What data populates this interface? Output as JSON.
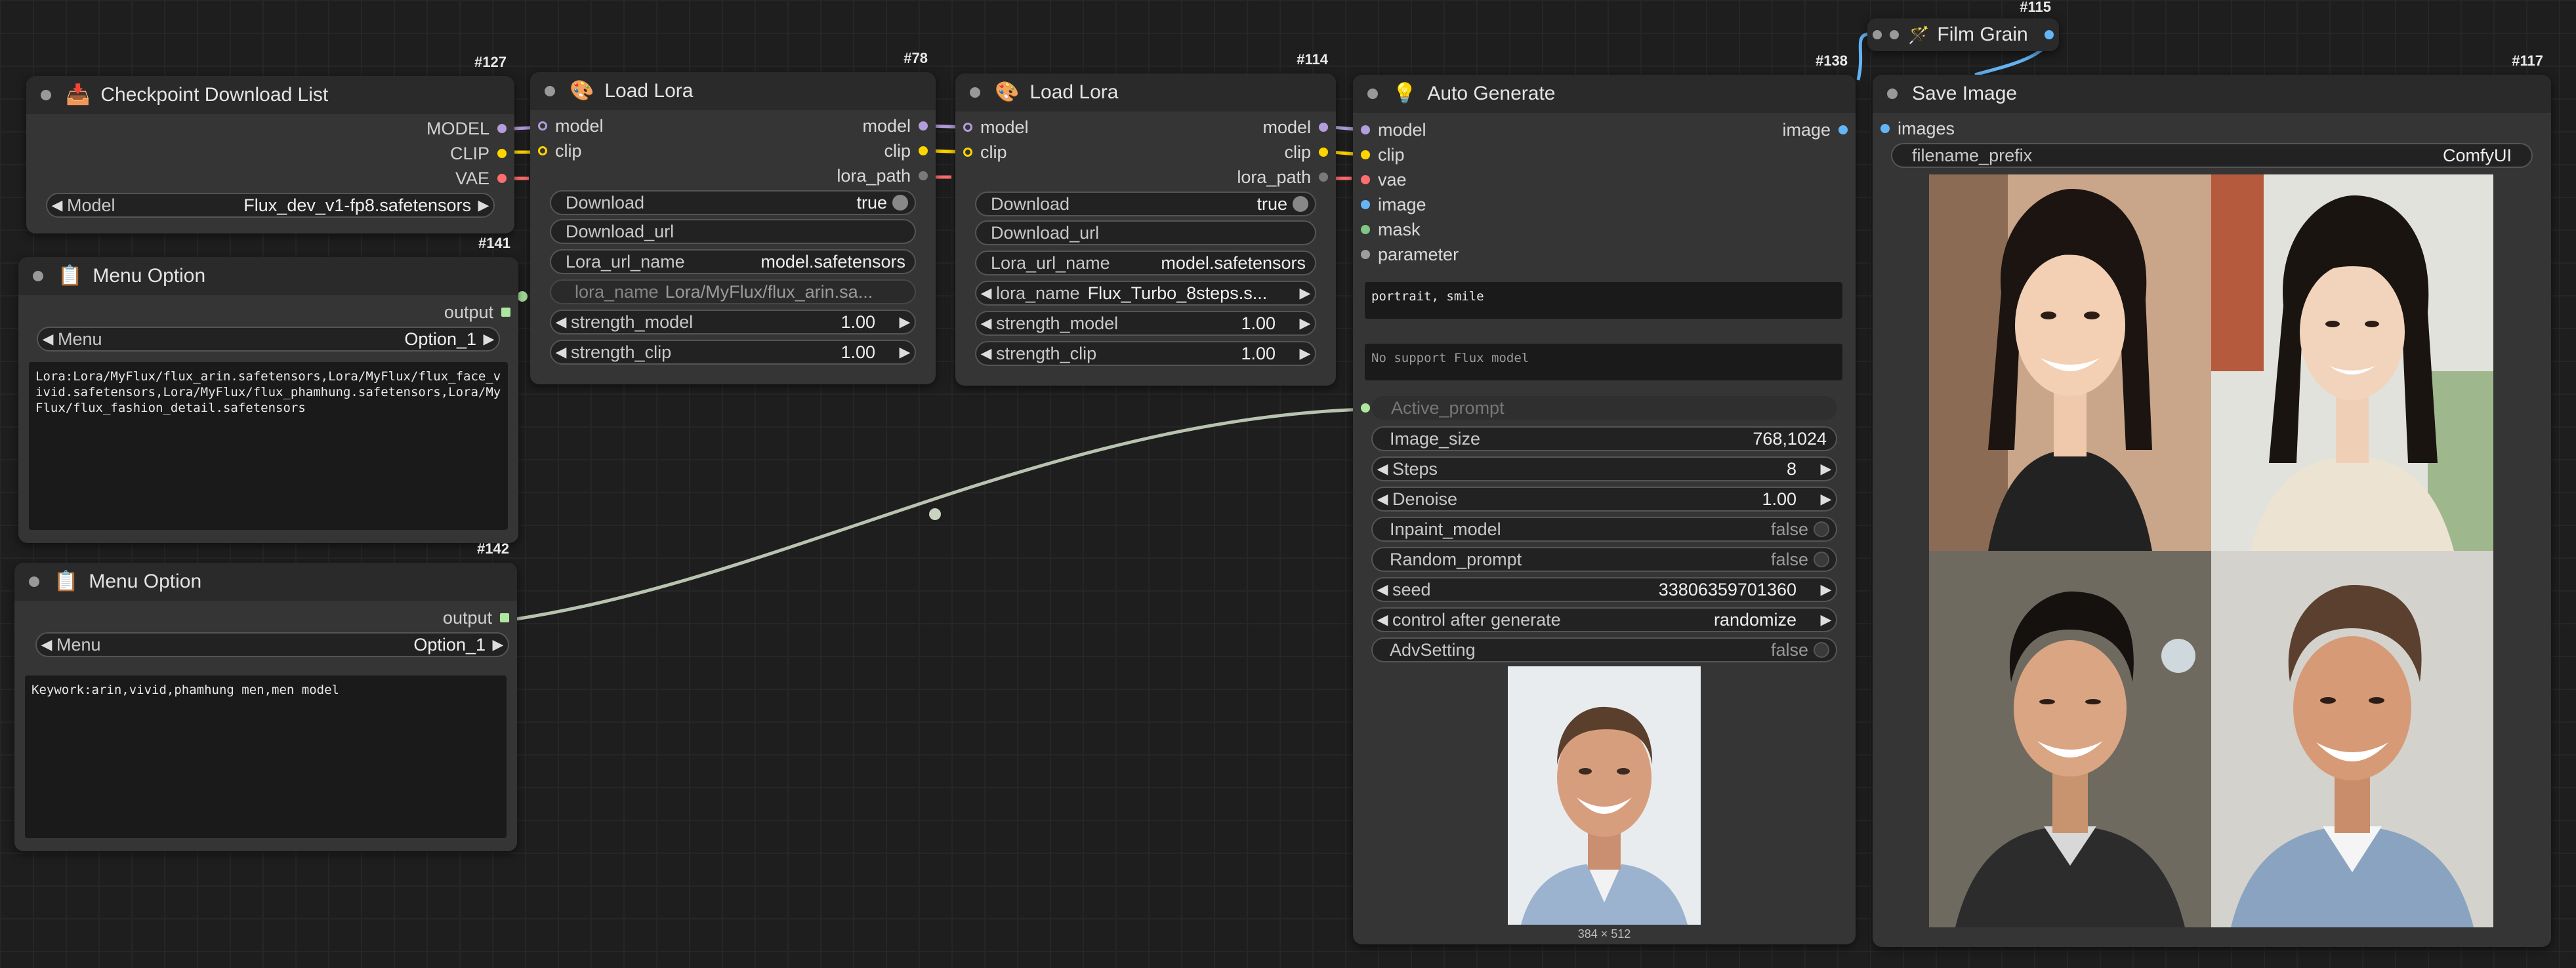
{
  "colors": {
    "model": "#b39ddb",
    "clip": "#ffd500",
    "vae": "#ff6e6e",
    "lora_path": "#7a7a7a",
    "image": "#64b5f6",
    "mask": "#81c784",
    "parameter": "#9e9e9e",
    "string": "#aee8a0"
  },
  "nodes": {
    "checkpoint": {
      "id": "#127",
      "icon": "floppy-disk-icon",
      "title": "Checkpoint Download List",
      "outputs": {
        "model": "MODEL",
        "clip": "CLIP",
        "vae": "VAE"
      },
      "model_label": "Model",
      "model_value": "Flux_dev_v1-fp8.safetensors"
    },
    "menu1": {
      "id": "#141",
      "icon": "clipboard-icon",
      "title": "Menu Option",
      "output": "output",
      "menu_label": "Menu",
      "menu_value": "Option_1",
      "text": "Lora:Lora/MyFlux/flux_arin.safetensors,Lora/MyFlux/flux_face_vivid.safetensors,Lora/MyFlux/flux_phamhung.safetensors,Lora/MyFlux/flux_fashion_detail.safetensors"
    },
    "menu2": {
      "id": "#142",
      "icon": "clipboard-icon",
      "title": "Menu Option",
      "output": "output",
      "menu_label": "Menu",
      "menu_value": "Option_1",
      "text": "Keywork:arin,vivid,phamhung men,men model"
    },
    "lora1": {
      "id": "#78",
      "icon": "palette-icon",
      "title": "Load Lora",
      "in_model": "model",
      "in_clip": "clip",
      "out_model": "model",
      "out_clip": "clip",
      "out_lora_path": "lora_path",
      "download_label": "Download",
      "download_value": "true",
      "download_url_label": "Download_url",
      "lora_url_name_label": "Lora_url_name",
      "lora_url_name_value": "model.safetensors",
      "lora_name_label": "lora_name",
      "lora_name_value": "Lora/MyFlux/flux_arin.sa...",
      "strength_model_label": "strength_model",
      "strength_model_value": "1.00",
      "strength_clip_label": "strength_clip",
      "strength_clip_value": "1.00"
    },
    "lora2": {
      "id": "#114",
      "icon": "palette-icon",
      "title": "Load Lora",
      "in_model": "model",
      "in_clip": "clip",
      "out_model": "model",
      "out_clip": "clip",
      "out_lora_path": "lora_path",
      "download_label": "Download",
      "download_value": "true",
      "download_url_label": "Download_url",
      "lora_url_name_label": "Lora_url_name",
      "lora_url_name_value": "model.safetensors",
      "lora_name_label": "lora_name",
      "lora_name_value": "Flux_Turbo_8steps.s...",
      "strength_model_label": "strength_model",
      "strength_model_value": "1.00",
      "strength_clip_label": "strength_clip",
      "strength_clip_value": "1.00"
    },
    "auto": {
      "id": "#138",
      "icon": "lightbulb-icon",
      "title": "Auto Generate",
      "inputs": {
        "model": "model",
        "clip": "clip",
        "vae": "vae",
        "image": "image",
        "mask": "mask",
        "parameter": "parameter"
      },
      "output_image": "image",
      "prompt_text": "portrait, smile",
      "info_text": "No support Flux model",
      "active_prompt": "Active_prompt",
      "image_size_label": "Image_size",
      "image_size_value": "768,1024",
      "steps_label": "Steps",
      "steps_value": "8",
      "denoise_label": "Denoise",
      "denoise_value": "1.00",
      "inpaint_label": "Inpaint_model",
      "inpaint_value": "false",
      "random_label": "Random_prompt",
      "random_value": "false",
      "seed_label": "seed",
      "seed_value": "33806359701360",
      "control_label": "control after generate",
      "control_value": "randomize",
      "adv_label": "AdvSetting",
      "adv_value": "false",
      "preview_caption": "384 × 512"
    },
    "film": {
      "id": "#115",
      "icon": "magic-wand-icon",
      "title": "Film Grain"
    },
    "save": {
      "id": "#117",
      "icon": "",
      "title": "Save Image",
      "input_images": "images",
      "prefix_label": "filename_prefix",
      "prefix_value": "ComfyUI"
    }
  }
}
